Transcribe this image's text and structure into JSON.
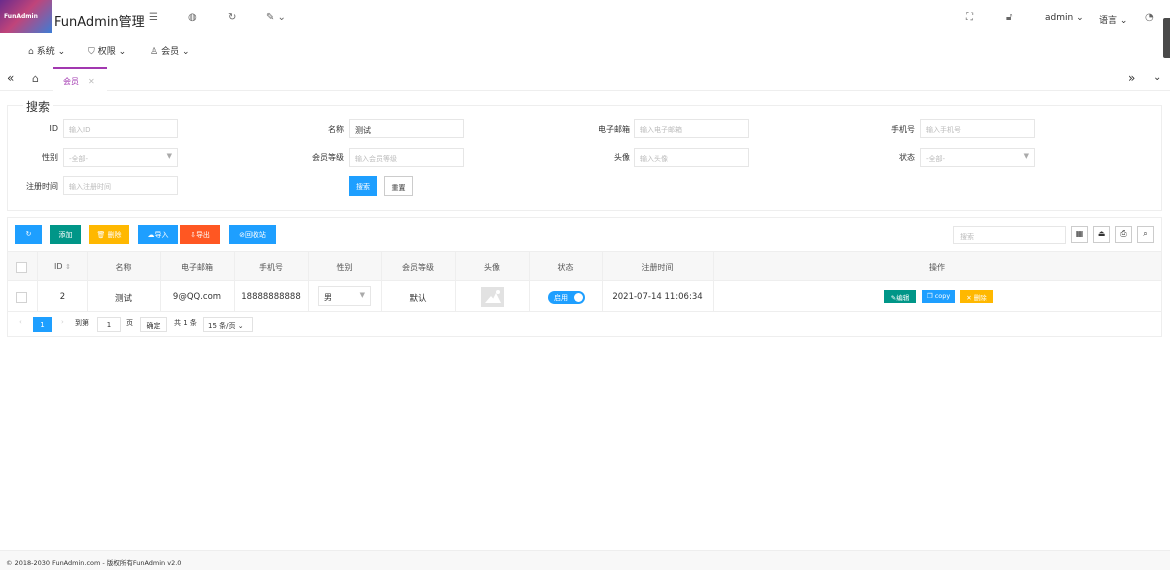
{
  "header": {
    "brand": "FunAdmin管理",
    "logo_text": "FunAdmin",
    "user": "admin",
    "language": "语言",
    "icons": [
      "menu-fold-icon",
      "globe-icon",
      "refresh-icon",
      "brush-icon",
      "fullscreen-icon",
      "lock-icon",
      "theme-icon"
    ]
  },
  "menu": [
    {
      "label": "系统",
      "icon": "home-icon"
    },
    {
      "label": "权限",
      "icon": "shield-icon"
    },
    {
      "label": "会员",
      "icon": "user-icon"
    }
  ],
  "tabs": {
    "active": "会员"
  },
  "search": {
    "legend": "搜索",
    "fields": {
      "id": {
        "label": "ID",
        "placeholder": "输入ID"
      },
      "name": {
        "label": "名称",
        "value": "测试"
      },
      "email": {
        "label": "电子邮箱",
        "placeholder": "输入电子邮箱"
      },
      "mobile": {
        "label": "手机号",
        "placeholder": "输入手机号"
      },
      "sex": {
        "label": "性别",
        "placeholder": "-全部-"
      },
      "level": {
        "label": "会员等级",
        "placeholder": "输入会员等级"
      },
      "avatar": {
        "label": "头像",
        "placeholder": "输入头像"
      },
      "status": {
        "label": "状态",
        "placeholder": "-全部-"
      },
      "created": {
        "label": "注册时间",
        "placeholder": "输入注册时间"
      }
    },
    "search_btn": "搜索",
    "reset_btn": "重置"
  },
  "toolbar": {
    "add": "添加",
    "delete": "删除",
    "import": "导入",
    "export": "导出",
    "recycle": "回收站",
    "search_placeholder": "搜索"
  },
  "table": {
    "columns": [
      "ID",
      "名称",
      "电子邮箱",
      "手机号",
      "性别",
      "会员等级",
      "头像",
      "状态",
      "注册时间",
      "操作"
    ],
    "rows": [
      {
        "id": "2",
        "name": "测试",
        "email": "9@QQ.com",
        "mobile": "18888888888",
        "sex": "男",
        "level": "默认",
        "status": "启用",
        "created": "2021-07-14 11:06:34",
        "actions": {
          "edit": "编辑",
          "copy": "copy",
          "delete": "删除"
        }
      }
    ]
  },
  "pager": {
    "current": "1",
    "goto": "到第",
    "page_input": "1",
    "page_unit": "页",
    "confirm": "确定",
    "total": "共 1 条",
    "size": "15 条/页"
  },
  "footer": "© 2018-2030 FunAdmin.com - 版权所有FunAdmin v2.0",
  "colors": {
    "accent": "#a238b0",
    "blue": "#1e9fff",
    "green": "#009688",
    "yellow": "#ffb800",
    "orange": "#ff5722"
  }
}
